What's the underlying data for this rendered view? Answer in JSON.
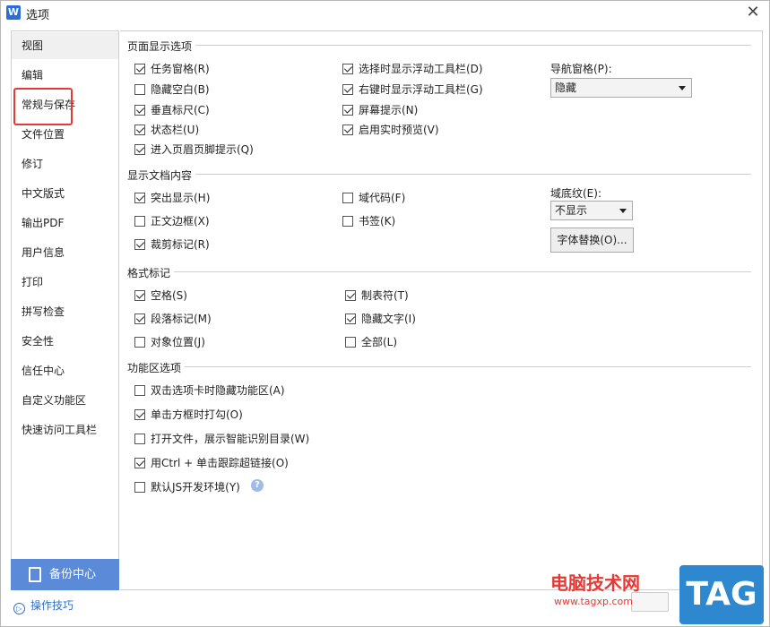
{
  "window": {
    "title": "选项",
    "app_icon_letter": "W"
  },
  "sidebar": {
    "items": [
      {
        "label": "视图"
      },
      {
        "label": "编辑"
      },
      {
        "label": "常规与保存"
      },
      {
        "label": "文件位置"
      },
      {
        "label": "修订"
      },
      {
        "label": "中文版式"
      },
      {
        "label": "输出PDF"
      },
      {
        "label": "用户信息"
      },
      {
        "label": "打印"
      },
      {
        "label": "拼写检查"
      },
      {
        "label": "安全性"
      },
      {
        "label": "信任中心"
      },
      {
        "label": "自定义功能区"
      },
      {
        "label": "快速访问工具栏"
      }
    ],
    "active_index": 0,
    "highlighted_index": 1,
    "backup_label": "备份中心",
    "tips_label": "操作技巧"
  },
  "page_display": {
    "title": "页面显示选项",
    "options": [
      {
        "label": "任务窗格(R)",
        "checked": true
      },
      {
        "label": "隐藏空白(B)",
        "checked": false
      },
      {
        "label": "垂直标尺(C)",
        "checked": true
      },
      {
        "label": "状态栏(U)",
        "checked": true
      },
      {
        "label": "进入页眉页脚提示(Q)",
        "checked": true
      },
      {
        "label": "选择时显示浮动工具栏(D)",
        "checked": true
      },
      {
        "label": "右键时显示浮动工具栏(G)",
        "checked": true
      },
      {
        "label": "屏幕提示(N)",
        "checked": true
      },
      {
        "label": "启用实时预览(V)",
        "checked": true
      }
    ],
    "nav_pane_label": "导航窗格(P):",
    "nav_pane_value": "隐藏"
  },
  "doc_content": {
    "title": "显示文档内容",
    "options": [
      {
        "label": "突出显示(H)",
        "checked": true
      },
      {
        "label": "正文边框(X)",
        "checked": false
      },
      {
        "label": "裁剪标记(R)",
        "checked": true
      },
      {
        "label": "域代码(F)",
        "checked": false
      },
      {
        "label": "书签(K)",
        "checked": false
      }
    ],
    "field_shading_label": "域底纹(E):",
    "field_shading_value": "不显示",
    "font_replace_button": "字体替换(O)..."
  },
  "format_marks": {
    "title": "格式标记",
    "options": [
      {
        "label": "空格(S)",
        "checked": true
      },
      {
        "label": "段落标记(M)",
        "checked": true
      },
      {
        "label": "对象位置(J)",
        "checked": false
      },
      {
        "label": "制表符(T)",
        "checked": true
      },
      {
        "label": "隐藏文字(I)",
        "checked": true
      },
      {
        "label": "全部(L)",
        "checked": false
      }
    ]
  },
  "ribbon": {
    "title": "功能区选项",
    "options": [
      {
        "label": "双击选项卡时隐藏功能区(A)",
        "checked": false
      },
      {
        "label": "单击方框时打勾(O)",
        "checked": true
      },
      {
        "label": "打开文件，展示智能识别目录(W)",
        "checked": false
      },
      {
        "label": "用Ctrl + 单击跟踪超链接(O)",
        "checked": true
      },
      {
        "label": "默认JS开发环境(Y)",
        "checked": false
      }
    ]
  },
  "watermark": {
    "site_name": "电脑技术网",
    "url": "www.tagxp.com",
    "tag": "TAG"
  }
}
